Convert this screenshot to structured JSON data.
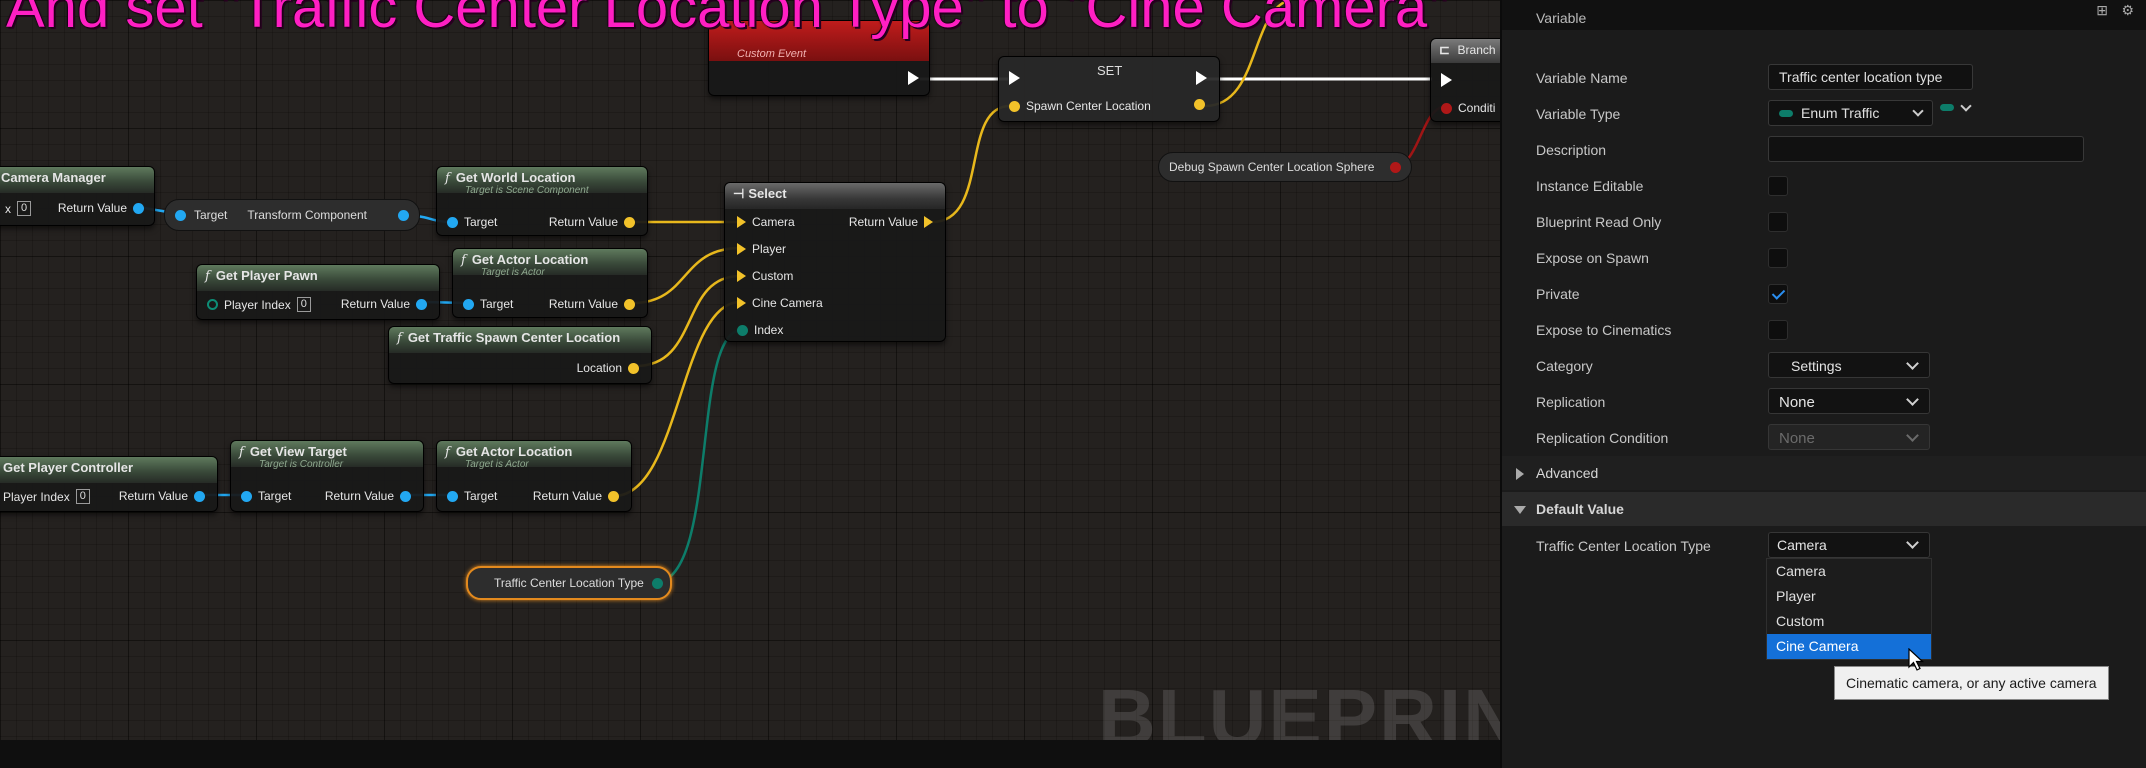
{
  "overlay_caption": "And set \"Traffic Center Location Type\" to \"Cine Camera\"",
  "watermark": "BLUEPRINT",
  "graph": {
    "custom_event": {
      "subtitle": "Custom Event"
    },
    "set_node": {
      "title": "SET",
      "pin": "Spawn Center Location"
    },
    "branch_node": {
      "title": "Branch",
      "pin": "Conditi"
    },
    "debug_node": {
      "label": "Debug Spawn Center Location Sphere"
    },
    "camera_manager": {
      "title": "Camera Manager",
      "index_value": "0",
      "return": "Return Value"
    },
    "transform_pill": {
      "target": "Target",
      "output": "Transform Component"
    },
    "get_world_location": {
      "title": "Get World Location",
      "subtitle": "Target is Scene Component",
      "target": "Target",
      "return": "Return Value"
    },
    "get_player_pawn": {
      "title": "Get Player Pawn",
      "index_label": "Player Index",
      "index_value": "0",
      "return": "Return Value"
    },
    "get_actor_location_1": {
      "title": "Get Actor Location",
      "subtitle": "Target is Actor",
      "target": "Target",
      "return": "Return Value"
    },
    "get_traffic_spawn": {
      "title": "Get Traffic Spawn Center Location",
      "output": "Location"
    },
    "select_node": {
      "title": "Select",
      "options": [
        "Camera",
        "Player",
        "Custom",
        "Cine Camera",
        "Index"
      ],
      "return": "Return Value"
    },
    "get_player_controller": {
      "title": "Get Player Controller",
      "index_label": "Player Index",
      "index_value": "0",
      "return": "Return Value"
    },
    "get_view_target": {
      "title": "Get View Target",
      "subtitle": "Target is Controller",
      "target": "Target",
      "return": "Return Value"
    },
    "get_actor_location_2": {
      "title": "Get Actor Location",
      "subtitle": "Target is Actor",
      "target": "Target",
      "return": "Return Value"
    },
    "traffic_var": {
      "label": "Traffic Center Location Type"
    }
  },
  "details": {
    "section_variable": "Variable",
    "rows": {
      "variable_name": {
        "label": "Variable Name",
        "value": "Traffic center location type"
      },
      "variable_type": {
        "label": "Variable Type",
        "value": "Enum Traffic"
      },
      "description": {
        "label": "Description",
        "value": ""
      },
      "instance_editable": {
        "label": "Instance Editable",
        "checked": false
      },
      "blueprint_read_only": {
        "label": "Blueprint Read Only",
        "checked": false
      },
      "expose_on_spawn": {
        "label": "Expose on Spawn",
        "checked": false
      },
      "private": {
        "label": "Private",
        "checked": true
      },
      "expose_to_cinematics": {
        "label": "Expose to Cinematics",
        "checked": false
      },
      "category": {
        "label": "Category",
        "value": "Settings"
      },
      "replication": {
        "label": "Replication",
        "value": "None"
      },
      "replication_condition": {
        "label": "Replication Condition",
        "value": "None"
      }
    },
    "advanced_label": "Advanced",
    "default_value_label": "Default Value",
    "default_row": {
      "label": "Traffic Center Location Type",
      "value": "Camera"
    },
    "dropdown_options": [
      "Camera",
      "Player",
      "Custom",
      "Cine Camera"
    ],
    "highlighted_option": "Cine Camera",
    "tooltip": "Cinematic camera, or any active camera"
  },
  "colors": {
    "caption": "#ff1fc3",
    "object_pin": "#22a8f2",
    "vector_pin": "#f2c22a",
    "enum_pin": "#0d7d6a",
    "selection": "#1470d8",
    "checkbox": "#2a8ef0"
  }
}
